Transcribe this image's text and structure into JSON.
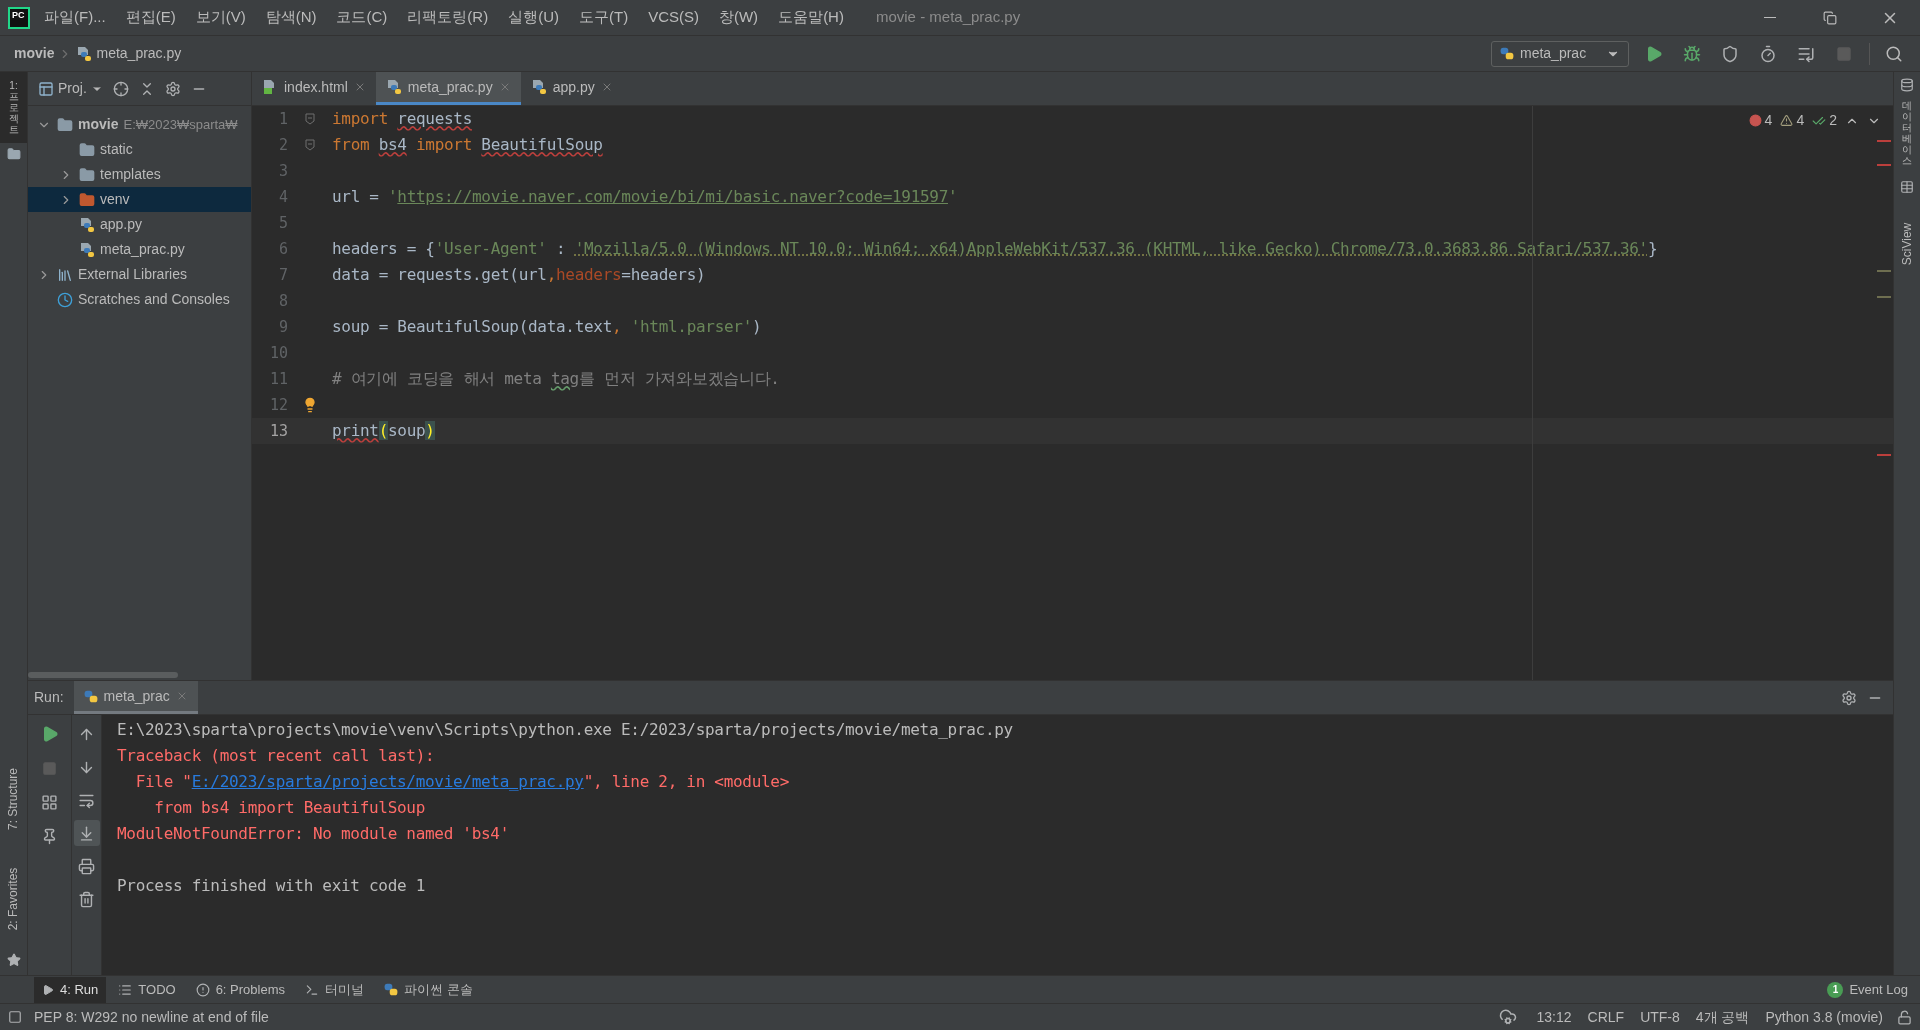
{
  "window": {
    "logo": "PC",
    "title": "movie - meta_prac.py"
  },
  "menu": [
    "파일(F)...",
    "편집(E)",
    "보기(V)",
    "탐색(N)",
    "코드(C)",
    "리팩토링(R)",
    "실행(U)",
    "도구(T)",
    "VCS(S)",
    "창(W)",
    "도움말(H)"
  ],
  "breadcrumbs": [
    {
      "label": "movie",
      "kind": "folder"
    },
    {
      "label": "meta_prac.py",
      "kind": "python"
    }
  ],
  "run_config": {
    "label": "meta_prac"
  },
  "toolbar": [
    {
      "kind": "run",
      "disabled": false
    },
    {
      "kind": "debug",
      "disabled": false
    },
    {
      "kind": "coverage",
      "disabled": false
    },
    {
      "kind": "profile",
      "disabled": false
    },
    {
      "kind": "concurrency",
      "disabled": false
    },
    {
      "kind": "stop",
      "disabled": true
    }
  ],
  "left_stripe_top": [
    {
      "label": "1: 프로젝트",
      "kind": "stacked",
      "selected": true
    }
  ],
  "left_stripe_bottom": [
    {
      "label": "7: Structure",
      "kind": "rotated",
      "selected": false
    },
    {
      "label": "2: Favorites",
      "kind": "rotated",
      "selected": false
    }
  ],
  "right_stripe": [
    {
      "label": "데이터베이스",
      "kind": "stacked",
      "selected": false
    },
    {
      "label": "SciView",
      "kind": "rotated",
      "selected": false
    }
  ],
  "project": {
    "title": "Proj.",
    "tree": [
      {
        "label": "movie",
        "kind": "folder",
        "expanded": true,
        "selected": false,
        "path": "E:₩2023₩sparta₩",
        "children": [
          {
            "label": "static",
            "kind": "folder",
            "selected": false
          },
          {
            "label": "templates",
            "kind": "folder",
            "expanded": false,
            "selected": false
          },
          {
            "label": "venv",
            "kind": "excluded-folder",
            "expanded": false,
            "selected": true
          },
          {
            "label": "app.py",
            "kind": "python",
            "selected": false
          },
          {
            "label": "meta_prac.py",
            "kind": "python",
            "selected": false
          }
        ]
      },
      {
        "label": "External Libraries",
        "kind": "library",
        "expanded": false,
        "selected": false
      },
      {
        "label": "Scratches and Consoles",
        "kind": "scratches",
        "selected": false
      }
    ]
  },
  "editor_tabs": [
    {
      "label": "index.html",
      "kind": "html",
      "selected": false
    },
    {
      "label": "meta_prac.py",
      "kind": "python",
      "selected": true
    },
    {
      "label": "app.py",
      "kind": "python",
      "selected": false
    }
  ],
  "inspections": {
    "errors": "4",
    "warnings": "4",
    "typos": "2"
  },
  "lines": [
    {
      "n": "1",
      "current": false,
      "kind": "fold",
      "tokens": [
        {
          "text": "import ",
          "kind": "keyword"
        },
        {
          "text": "requests",
          "kind": "unresolved"
        }
      ]
    },
    {
      "n": "2",
      "current": false,
      "kind": "fold",
      "tokens": [
        {
          "text": "from ",
          "kind": "keyword"
        },
        {
          "text": "bs4",
          "kind": "unresolved"
        },
        {
          "text": " import ",
          "kind": "keyword"
        },
        {
          "text": "BeautifulSoup",
          "kind": "unresolved"
        }
      ]
    },
    {
      "n": "3",
      "current": false,
      "kind": "blank"
    },
    {
      "n": "4",
      "current": false,
      "kind": "code",
      "tokens": [
        {
          "text": "url = ",
          "kind": "plain"
        },
        {
          "text": "'",
          "kind": "string"
        },
        {
          "text": "https://movie.naver.com/movie/bi/mi/basic.naver?code=191597",
          "kind": "url"
        },
        {
          "text": "'",
          "kind": "string"
        }
      ]
    },
    {
      "n": "5",
      "current": false,
      "kind": "blank"
    },
    {
      "n": "6",
      "current": false,
      "kind": "code",
      "tokens": [
        {
          "text": "headers = {",
          "kind": "plain"
        },
        {
          "text": "'User-Agent'",
          "kind": "string"
        },
        {
          "text": " : ",
          "kind": "plain"
        },
        {
          "text": "'Mozilla/5.0 (Windows NT 10.0; Win64; x64)AppleWebKit/537.36 (KHTML, like Gecko) Chrome/73.0.3683.86 Safari/537.36'",
          "kind": "string-warn"
        },
        {
          "text": "}",
          "kind": "plain"
        }
      ]
    },
    {
      "n": "7",
      "current": false,
      "kind": "code",
      "tokens": [
        {
          "text": "data = requests.get(url",
          "kind": "plain"
        },
        {
          "text": ",",
          "kind": "keyword"
        },
        {
          "text": "headers",
          "kind": "param"
        },
        {
          "text": "=headers)",
          "kind": "plain"
        }
      ]
    },
    {
      "n": "8",
      "current": false,
      "kind": "blank"
    },
    {
      "n": "9",
      "current": false,
      "kind": "code",
      "tokens": [
        {
          "text": "soup = BeautifulSoup(data.text",
          "kind": "plain"
        },
        {
          "text": ", ",
          "kind": "keyword"
        },
        {
          "text": "'html.parser'",
          "kind": "string"
        },
        {
          "text": ")",
          "kind": "plain"
        }
      ]
    },
    {
      "n": "10",
      "current": false,
      "kind": "blank"
    },
    {
      "n": "11",
      "current": false,
      "kind": "code",
      "tokens": [
        {
          "text": "# 여기에 코딩을 해서 meta ",
          "kind": "comment"
        },
        {
          "text": "tag",
          "kind": "typo"
        },
        {
          "text": "를 먼저 가져와보겠습니다.",
          "kind": "comment"
        }
      ]
    },
    {
      "n": "12",
      "current": false,
      "kind": "bulb"
    },
    {
      "n": "13",
      "current": true,
      "kind": "code",
      "tokens": [
        {
          "text": "print",
          "kind": "unresolved"
        },
        {
          "text": "(",
          "kind": "paren"
        },
        {
          "text": "soup",
          "kind": "plain"
        },
        {
          "text": ")",
          "kind": "paren"
        }
      ]
    }
  ],
  "run": {
    "label": "Run:",
    "tab": "meta_prac",
    "tools_left": [
      {
        "kind": "rerun",
        "disabled": false
      },
      {
        "kind": "stop",
        "disabled": true
      },
      {
        "kind": "layout",
        "disabled": false
      },
      {
        "kind": "pin",
        "disabled": false
      }
    ],
    "tools_right": [
      {
        "kind": "up",
        "selected": false
      },
      {
        "kind": "down",
        "selected": false
      },
      {
        "kind": "wrap",
        "selected": false
      },
      {
        "kind": "scroll-end",
        "selected": true
      },
      {
        "kind": "print",
        "selected": false
      },
      {
        "kind": "trash",
        "selected": false
      }
    ],
    "console": [
      {
        "kind": "output",
        "tokens": [
          {
            "text": "E:\\2023\\sparta\\projects\\movie\\venv\\Scripts\\python.exe E:/2023/sparta/projects/movie/meta_prac.py",
            "kind": "plain"
          }
        ]
      },
      {
        "kind": "output",
        "tokens": [
          {
            "text": "Traceback (most recent call last):",
            "kind": "error"
          }
        ]
      },
      {
        "kind": "output",
        "tokens": [
          {
            "text": "  File \"",
            "kind": "error"
          },
          {
            "text": "E:/2023/sparta/projects/movie/meta_prac.py",
            "kind": "link"
          },
          {
            "text": "\", line 2, in <module>",
            "kind": "error"
          }
        ]
      },
      {
        "kind": "output",
        "tokens": [
          {
            "text": "    from bs4 import BeautifulSoup",
            "kind": "error"
          }
        ]
      },
      {
        "kind": "output",
        "tokens": [
          {
            "text": "ModuleNotFoundError: No module named 'bs4'",
            "kind": "error"
          }
        ]
      },
      {
        "kind": "blank"
      },
      {
        "kind": "output",
        "tokens": [
          {
            "text": "Process finished with exit code 1",
            "kind": "plain"
          }
        ]
      }
    ]
  },
  "bottom_tools": [
    {
      "label": "4: Run",
      "kind": "run",
      "selected": true
    },
    {
      "label": "TODO",
      "kind": "todo",
      "selected": false
    },
    {
      "label": "6: Problems",
      "kind": "problems",
      "selected": false
    },
    {
      "label": "터미널",
      "kind": "terminal",
      "selected": false
    },
    {
      "label": "파이썬 콘솔",
      "kind": "python",
      "selected": false
    }
  ],
  "event_log": {
    "label": "Event Log",
    "count": "1"
  },
  "status": {
    "message": "PEP 8: W292 no newline at end of file",
    "items": [
      "13:12",
      "CRLF",
      "UTF-8",
      "4개 공백",
      "Python 3.8 (movie)"
    ]
  }
}
